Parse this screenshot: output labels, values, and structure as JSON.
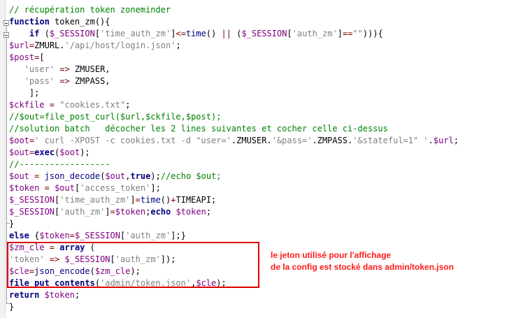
{
  "editor": {
    "lines": [
      [
        [
          "c",
          "// récupération token zoneminder"
        ]
      ],
      [
        [
          "k",
          "function "
        ],
        [
          "p",
          "token_zm(){"
        ]
      ],
      [
        [
          "p",
          "    "
        ],
        [
          "k",
          "if "
        ],
        [
          "p",
          "("
        ],
        [
          "v",
          "$_SESSION"
        ],
        [
          "p",
          "["
        ],
        [
          "s",
          "'time_auth_zm'"
        ],
        [
          "p",
          "]"
        ],
        [
          "o",
          "<="
        ],
        [
          "f",
          "time"
        ],
        [
          "p",
          "() "
        ],
        [
          "o",
          "||"
        ],
        [
          "p",
          " ("
        ],
        [
          "v",
          "$_SESSION"
        ],
        [
          "p",
          "["
        ],
        [
          "s",
          "'auth_zm'"
        ],
        [
          "p",
          "]"
        ],
        [
          "o",
          "=="
        ],
        [
          "s",
          "\"\""
        ],
        [
          "p",
          "))){"
        ]
      ],
      [
        [
          "v",
          "$url"
        ],
        [
          "o",
          "="
        ],
        [
          "p",
          "ZMURL."
        ],
        [
          "s",
          "'/api/host/login.json'"
        ],
        [
          "p",
          ";"
        ]
      ],
      [
        [
          "v",
          "$post"
        ],
        [
          "o",
          "="
        ],
        [
          "p",
          "["
        ]
      ],
      [
        [
          "p",
          "   "
        ],
        [
          "s",
          "'user'"
        ],
        [
          "p",
          " "
        ],
        [
          "o",
          "=>"
        ],
        [
          "p",
          " ZMUSER,"
        ]
      ],
      [
        [
          "p",
          "   "
        ],
        [
          "s",
          "'pass'"
        ],
        [
          "p",
          " "
        ],
        [
          "o",
          "=>"
        ],
        [
          "p",
          " ZMPASS,"
        ]
      ],
      [
        [
          "p",
          "    ];"
        ]
      ],
      [
        [
          "v",
          "$ckfile"
        ],
        [
          "p",
          " "
        ],
        [
          "o",
          "="
        ],
        [
          "p",
          " "
        ],
        [
          "s",
          "\"cookies.txt\""
        ],
        [
          "p",
          ";"
        ]
      ],
      [
        [
          "c",
          "//$out=file_post_curl($url,$ckfile,$post);"
        ]
      ],
      [
        [
          "c",
          "//solution batch   décocher les 2 lines suivantes et cocher celle ci-dessus"
        ]
      ],
      [
        [
          "v",
          "$oot"
        ],
        [
          "o",
          "="
        ],
        [
          "s",
          "' curl -XPOST -c cookies.txt -d \"user='"
        ],
        [
          "p",
          ".ZMUSER."
        ],
        [
          "s",
          "'&pass='"
        ],
        [
          "p",
          ".ZMPASS."
        ],
        [
          "s",
          "'&stateful=1\" '"
        ],
        [
          "p",
          "."
        ],
        [
          "v",
          "$url"
        ],
        [
          "p",
          ";"
        ]
      ],
      [
        [
          "v",
          "$out"
        ],
        [
          "o",
          "="
        ],
        [
          "k",
          "exec"
        ],
        [
          "p",
          "("
        ],
        [
          "v",
          "$oot"
        ],
        [
          "p",
          ");"
        ]
      ],
      [
        [
          "c",
          "//------------------"
        ]
      ],
      [
        [
          "v",
          "$out"
        ],
        [
          "p",
          " "
        ],
        [
          "o",
          "="
        ],
        [
          "p",
          " "
        ],
        [
          "f",
          "json_decode"
        ],
        [
          "p",
          "("
        ],
        [
          "v",
          "$out"
        ],
        [
          "p",
          ","
        ],
        [
          "k",
          "true"
        ],
        [
          "p",
          ");"
        ],
        [
          "c",
          "//echo $out;"
        ]
      ],
      [
        [
          "v",
          "$token"
        ],
        [
          "p",
          " "
        ],
        [
          "o",
          "="
        ],
        [
          "p",
          " "
        ],
        [
          "v",
          "$out"
        ],
        [
          "p",
          "["
        ],
        [
          "s",
          "'access_token'"
        ],
        [
          "p",
          "];"
        ]
      ],
      [
        [
          "v",
          "$_SESSION"
        ],
        [
          "p",
          "["
        ],
        [
          "s",
          "'time_auth_zm'"
        ],
        [
          "p",
          "]"
        ],
        [
          "o",
          "="
        ],
        [
          "f",
          "time"
        ],
        [
          "p",
          "()"
        ],
        [
          "o",
          "+"
        ],
        [
          "p",
          "TIMEAPI;"
        ]
      ],
      [
        [
          "v",
          "$_SESSION"
        ],
        [
          "p",
          "["
        ],
        [
          "s",
          "'auth_zm'"
        ],
        [
          "p",
          "]"
        ],
        [
          "o",
          "="
        ],
        [
          "v",
          "$token"
        ],
        [
          "p",
          ";"
        ],
        [
          "k",
          "echo "
        ],
        [
          "v",
          "$token"
        ],
        [
          "p",
          ";"
        ]
      ],
      [
        [
          "p",
          "}"
        ]
      ],
      [
        [
          "k",
          "else "
        ],
        [
          "p",
          "{"
        ],
        [
          "v",
          "$token"
        ],
        [
          "o",
          "="
        ],
        [
          "v",
          "$_SESSION"
        ],
        [
          "p",
          "["
        ],
        [
          "s",
          "'auth_zm'"
        ],
        [
          "p",
          "];}"
        ]
      ],
      [
        [
          "v",
          "$zm_cle"
        ],
        [
          "p",
          " "
        ],
        [
          "o",
          "="
        ],
        [
          "p",
          " "
        ],
        [
          "k",
          "array"
        ],
        [
          "p",
          " ("
        ]
      ],
      [
        [
          "s",
          "'token'"
        ],
        [
          "p",
          " "
        ],
        [
          "o",
          "=>"
        ],
        [
          "p",
          " "
        ],
        [
          "v",
          "$_SESSION"
        ],
        [
          "p",
          "["
        ],
        [
          "s",
          "'auth_zm'"
        ],
        [
          "p",
          "]);"
        ]
      ],
      [
        [
          "v",
          "$cle"
        ],
        [
          "o",
          "="
        ],
        [
          "f",
          "json_encode"
        ],
        [
          "p",
          "("
        ],
        [
          "v",
          "$zm_cle"
        ],
        [
          "p",
          ");"
        ]
      ],
      [
        [
          "k",
          "file_put_contents"
        ],
        [
          "p",
          "("
        ],
        [
          "s",
          "'admin/token.json'"
        ],
        [
          "p",
          ","
        ],
        [
          "v",
          "$cle"
        ],
        [
          "p",
          ");"
        ]
      ],
      [
        [
          "k",
          "return "
        ],
        [
          "v",
          "$token"
        ],
        [
          "p",
          ";"
        ]
      ],
      [
        [
          "p",
          "}"
        ]
      ]
    ]
  },
  "annotation": {
    "line1": "le jeton utilisé pour l'affichage",
    "line2": "de la config est stocké dans admin/token.json"
  }
}
